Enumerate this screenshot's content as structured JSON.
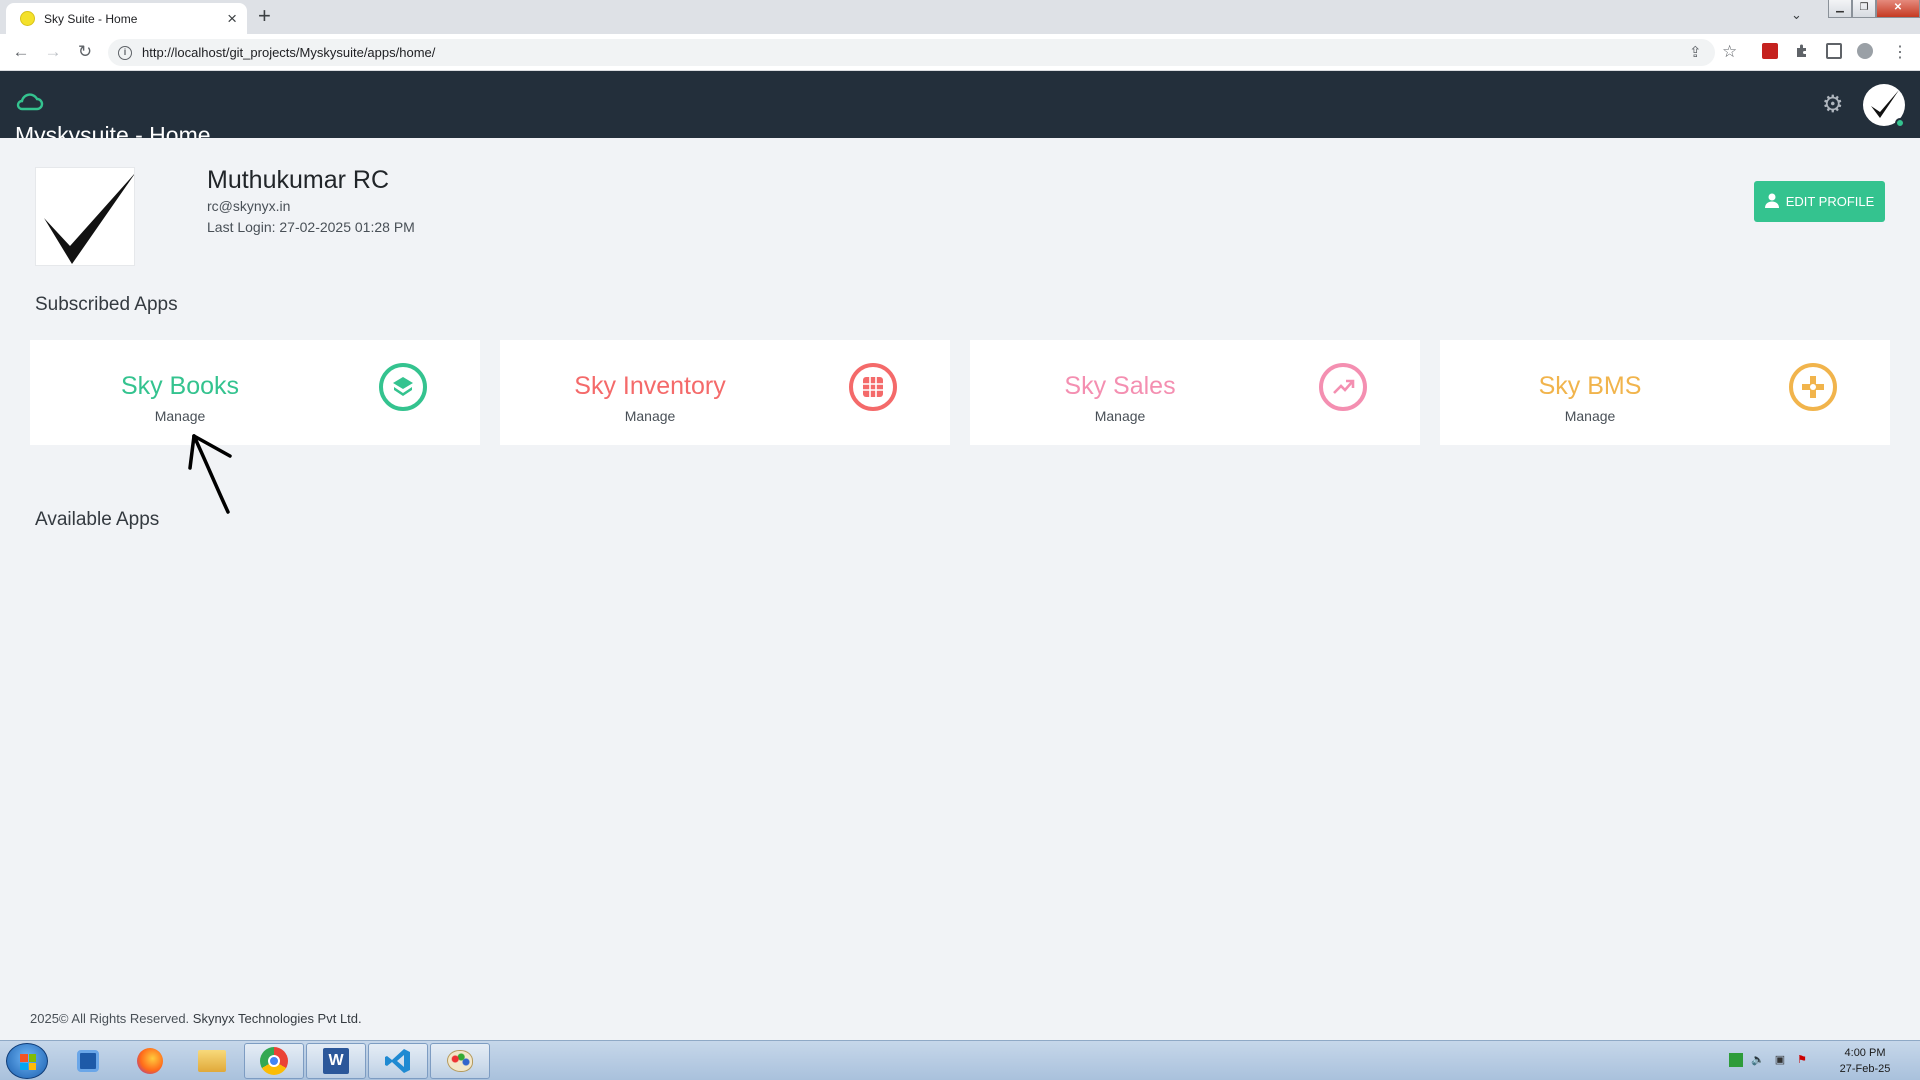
{
  "browser": {
    "tab_title": "Sky Suite - Home",
    "tab_close": "×",
    "new_tab": "+",
    "url": "http://localhost/git_projects/Myskysuite/apps/home/"
  },
  "header": {
    "title": "Myskysuite - Home",
    "accent_color": "#34c38f"
  },
  "profile": {
    "name": "Muthukumar RC",
    "email": "rc@skynyx.in",
    "last_login": "Last Login: 27-02-2025 01:28 PM",
    "edit_label": "EDIT PROFILE"
  },
  "subscribed": {
    "title": "Subscribed Apps",
    "apps": [
      {
        "name": "Sky Books",
        "action": "Manage",
        "color": "#34c38f",
        "icon": "layers-icon"
      },
      {
        "name": "Sky Inventory",
        "action": "Manage",
        "color": "#f46a6a",
        "icon": "grid-icon"
      },
      {
        "name": "Sky Sales",
        "action": "Manage",
        "color": "#f48fb1",
        "icon": "trend-up-icon"
      },
      {
        "name": "Sky BMS",
        "action": "Manage",
        "color": "#f1b44c",
        "icon": "gamepad-icon"
      }
    ]
  },
  "available": {
    "title": "Available Apps"
  },
  "footer": {
    "text": "2025© All Rights Reserved. ",
    "company": "Skynyx Technologies Pvt Ltd."
  },
  "taskbar": {
    "time": "4:00 PM",
    "date": "27-Feb-25"
  }
}
